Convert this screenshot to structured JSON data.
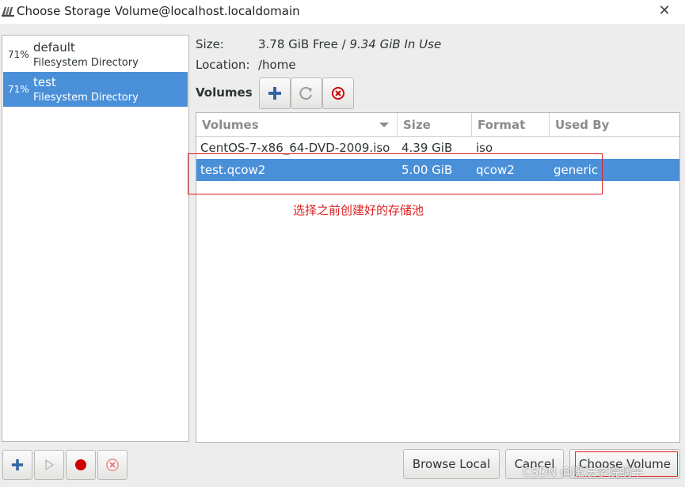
{
  "window": {
    "title": "Choose Storage Volume@localhost.localdomain",
    "app_icon": "virt-manager-icon",
    "close_glyph": "✕"
  },
  "pools": [
    {
      "percent": "71%",
      "name": "default",
      "type": "Filesystem Directory",
      "selected": false
    },
    {
      "percent": "71%",
      "name": "test",
      "type": "Filesystem Directory",
      "selected": true
    }
  ],
  "info": {
    "size_label": "Size:",
    "size_free": "3.78 GiB Free /",
    "size_in_use": "9.34 GiB In Use",
    "location_label": "Location:",
    "location_value": "/home"
  },
  "volumes_toolbar": {
    "heading": "Volumes",
    "add_icon": "plus-icon",
    "refresh_icon": "refresh-icon",
    "delete_icon": "delete-icon"
  },
  "volume_table": {
    "columns": [
      "Volumes",
      "Size",
      "Format",
      "Used By"
    ],
    "rows": [
      {
        "name": "CentOS-7-x86_64-DVD-2009.iso",
        "size": "4.39 GiB",
        "format": "iso",
        "used_by": "",
        "selected": false
      },
      {
        "name": "test.qcow2",
        "size": "5.00 GiB",
        "format": "qcow2",
        "used_by": "generic",
        "selected": true
      }
    ]
  },
  "annotation": {
    "text": "选择之前创建好的存储池",
    "color": "#e02020"
  },
  "bottom_toolbar": {
    "add_pool_icon": "plus-icon",
    "start_pool_icon": "play-icon",
    "stop_pool_icon": "record-icon",
    "delete_pool_icon": "delete-icon"
  },
  "actions": {
    "browse_local": "Browse Local",
    "cancel": "Cancel",
    "choose_volume": "Choose Volume"
  },
  "watermark": "CSDN @魔法学院蜗牛",
  "colors": {
    "selection": "#4a90d9",
    "accent_plus": "#3465a4",
    "danger": "#cc0000"
  }
}
